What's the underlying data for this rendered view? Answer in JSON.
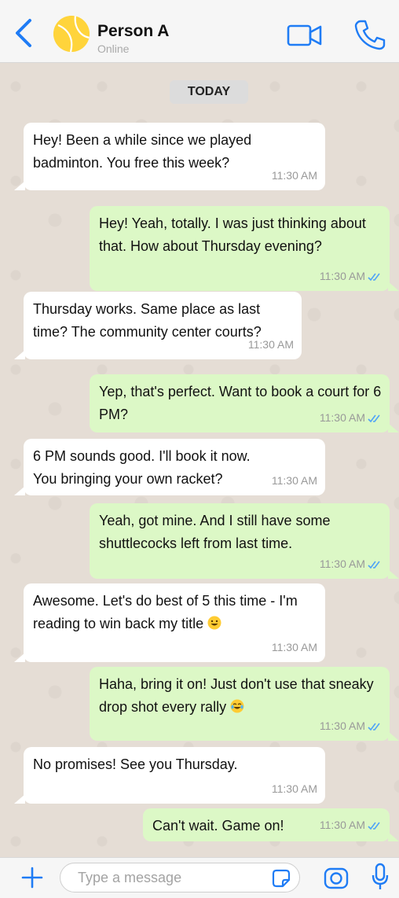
{
  "header": {
    "contact_name": "Person A",
    "contact_status": "Online",
    "icons": [
      "back-chevron-icon",
      "avatar",
      "video-call-icon",
      "phone-icon"
    ]
  },
  "chat": {
    "day_label": "TODAY",
    "messages": [
      {
        "dir": "in",
        "text": "Hey! Been a while since we played badminton. You free this week?",
        "time": "11:30 AM"
      },
      {
        "dir": "out",
        "text": "Hey! Yeah, totally. I was just thinking about that. How about Thursday evening?",
        "time": "11:30 AM",
        "status": "read"
      },
      {
        "dir": "in",
        "text": "Thursday works. Same place as last time? The community center courts?",
        "time": "11:30 AM"
      },
      {
        "dir": "out",
        "text": "Yep, that's perfect. Want to book a court for 6 PM?",
        "time": "11:30 AM",
        "status": "read"
      },
      {
        "dir": "in",
        "text": "6 PM sounds good. I'll book it now. You bringing your own racket?",
        "time": "11:30 AM"
      },
      {
        "dir": "out",
        "text": "Yeah, got mine. And I still have some shuttlecocks left from last time.",
        "time": "11:30 AM",
        "status": "read"
      },
      {
        "dir": "in",
        "text": "Awesome. Let's do best of 5 this time - I'm reading to win back my title",
        "time": "11:30 AM",
        "emoji": "grinning-face"
      },
      {
        "dir": "out",
        "text": "Haha, bring it on! Just don't use that sneaky drop shot every rally",
        "time": "11:30 AM",
        "status": "read",
        "emoji": "tears-of-joy-face"
      },
      {
        "dir": "in",
        "text": "No promises! See you Thursday.",
        "time": "11:30 AM"
      },
      {
        "dir": "out",
        "text": "Can't wait. Game on!",
        "time": "11:30 AM",
        "status": "read"
      }
    ]
  },
  "input": {
    "placeholder": "Type a message"
  },
  "colors": {
    "accent": "#1f7cf5",
    "incoming_bubble": "#ffffff",
    "outgoing_bubble": "#dcf8c6",
    "chat_background": "#e5ddd5",
    "read_ticks": "#4fa3f7"
  }
}
